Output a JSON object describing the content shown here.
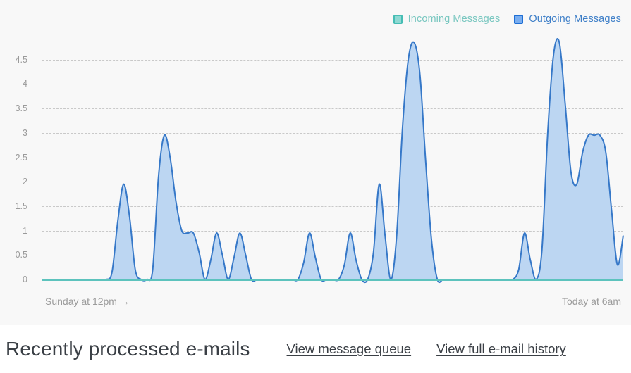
{
  "legend": {
    "items": [
      {
        "label": "Incoming Messages",
        "key": "incoming",
        "color": "#8fd9d3",
        "border": "#46bdb4",
        "text_color": "#79c7c0"
      },
      {
        "label": "Outgoing Messages",
        "key": "outgoing",
        "color": "#7aaef0",
        "border": "#1f6fd4",
        "text_color": "#3e7fc8"
      }
    ]
  },
  "axis": {
    "y_ticks": [
      "0",
      "0.5",
      "1",
      "1.5",
      "2",
      "2.5",
      "3",
      "3.5",
      "4",
      "4.5"
    ],
    "x_left_label": "Sunday at 12pm →",
    "x_right_label": "Today at 6am"
  },
  "footer": {
    "title": "Recently processed e-mails",
    "links": [
      {
        "label": "View message queue"
      },
      {
        "label": "View full e-mail history"
      }
    ]
  },
  "chart_data": {
    "type": "area",
    "title": "",
    "xlabel": "",
    "ylabel": "",
    "ylim": [
      0,
      4.9
    ],
    "y_ticks": [
      0,
      0.5,
      1,
      1.5,
      2,
      2.5,
      3,
      3.5,
      4,
      4.5
    ],
    "grid": true,
    "legend_position": "top-right",
    "x_axis_start": "Sunday at 12pm",
    "x_axis_end": "Today at 6am",
    "x_count": 101,
    "series": [
      {
        "name": "Incoming Messages",
        "color": "#5cc3bd",
        "fill": "#a8e0dc",
        "values": [
          0,
          0,
          0,
          0,
          0,
          0,
          0,
          0,
          0,
          0,
          0,
          0,
          0,
          0,
          0,
          0,
          0,
          0,
          0,
          0,
          0,
          0,
          0,
          0,
          0,
          0,
          0,
          0,
          0,
          0,
          0,
          0,
          0,
          0,
          0,
          0,
          0,
          0,
          0,
          0,
          0,
          0,
          0,
          0,
          0,
          0,
          0,
          0,
          0,
          0,
          0,
          0,
          0,
          0,
          0,
          0,
          0,
          0,
          0,
          0,
          0,
          0,
          0,
          0,
          0,
          0,
          0,
          0,
          0,
          0,
          0,
          0,
          0,
          0,
          0,
          0,
          0,
          0,
          0,
          0,
          0,
          0,
          0,
          0,
          0,
          0,
          0,
          0,
          0,
          0,
          0,
          0,
          0,
          0,
          0,
          0,
          0,
          0,
          0,
          0,
          0
        ]
      },
      {
        "name": "Outgoing Messages",
        "color": "#3678c8",
        "fill": "#bcd6f2",
        "values": [
          0,
          0,
          0,
          0,
          0,
          0,
          0,
          0,
          0,
          0,
          0,
          0,
          0.15,
          1.2,
          1.95,
          1.3,
          0.2,
          0,
          0,
          0.2,
          2.1,
          2.95,
          2.5,
          1.6,
          1.0,
          0.95,
          0.95,
          0.55,
          0,
          0.4,
          0.95,
          0.5,
          0,
          0.45,
          0.95,
          0.5,
          0,
          0,
          0,
          0,
          0,
          0,
          0,
          0,
          0,
          0.35,
          0.95,
          0.45,
          0,
          0,
          0,
          0,
          0.3,
          0.95,
          0.4,
          0,
          0,
          0.55,
          1.95,
          0.9,
          0,
          0.9,
          3.1,
          4.5,
          4.85,
          4.2,
          2.4,
          0.8,
          0,
          0,
          0,
          0,
          0,
          0,
          0,
          0,
          0,
          0,
          0,
          0,
          0,
          0,
          0.2,
          0.95,
          0.4,
          0,
          0.6,
          3.0,
          4.6,
          4.85,
          3.6,
          2.2,
          1.95,
          2.6,
          2.95,
          2.95,
          2.95,
          2.6,
          1.4,
          0.3,
          0.9
        ]
      }
    ]
  }
}
